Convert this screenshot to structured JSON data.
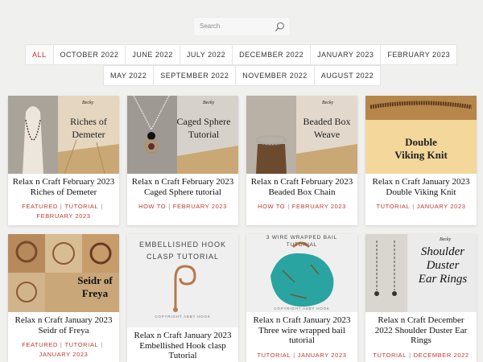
{
  "search": {
    "placeholder": "Search"
  },
  "filters": {
    "row1": [
      "ALL",
      "OCTOBER 2022",
      "JUNE 2022",
      "JULY 2022",
      "DECEMBER 2022",
      "JANUARY 2023",
      "FEBRUARY 2023"
    ],
    "row2": [
      "MAY 2022",
      "SEPTEMBER 2022",
      "NOVEMBER 2022",
      "AUGUST 2022"
    ],
    "active": "ALL"
  },
  "brand_mark": "Becky",
  "cards": [
    {
      "title": "Relax n Craft February 2023 Riches of Demeter",
      "thumb_text": [
        "Riches of",
        "Demeter"
      ],
      "tags": [
        "FEATURED",
        "TUTORIAL",
        "FEBRUARY 2023"
      ]
    },
    {
      "title": "Relax n Craft February 2023 Caged Sphere tutorial",
      "thumb_text": [
        "Caged Sphere",
        "Tutorial"
      ],
      "tags": [
        "HOW TO",
        "FEBRUARY 2023"
      ]
    },
    {
      "title": "Relax n Craft February 2023 Beaded Box Chain",
      "thumb_text": [
        "Beaded Box",
        "Weave"
      ],
      "tags": [
        "HOW TO",
        "FEBRUARY 2023"
      ]
    },
    {
      "title": "Relax n Craft January 2023 Double Viking Knit",
      "thumb_text": [
        "Double",
        "Viking Knit"
      ],
      "tags": [
        "TUTORIAL",
        "JANUARY 2023"
      ]
    },
    {
      "title": "Relax n Craft January 2023 Seidr of Freya",
      "thumb_text": [
        "Seidr of",
        "Freya"
      ],
      "tags": [
        "FEATURED",
        "TUTORIAL",
        "JANUARY 2023"
      ]
    },
    {
      "title": "Relax n Craft January 2023 Embellished Hook clasp Tutorial",
      "thumb_text": [
        "EMBELLISHED HOOK",
        "CLASP TUTORIAL",
        "COPYRIGHT ABBY HOOK"
      ],
      "tags": []
    },
    {
      "title": "Relax n Craft January 2023 Three wire wrapped bail tutorial",
      "thumb_text": [
        "3 WIRE WRAPPED BAIL",
        "TUTORIAL",
        "COPYRIGHT ABBY HOOK"
      ],
      "tags": [
        "TUTORIAL",
        "JANUARY 2023"
      ]
    },
    {
      "title": "Relax n Craft December 2022 Shoulder Duster Ear Rings",
      "thumb_text": [
        "Shoulder",
        "Duster",
        "Ear Rings"
      ],
      "tags": [
        "TUTORIAL",
        "DECEMBER 2022"
      ]
    }
  ],
  "colors": {
    "accent": "#c0392b",
    "background": "#f0f0ef"
  }
}
